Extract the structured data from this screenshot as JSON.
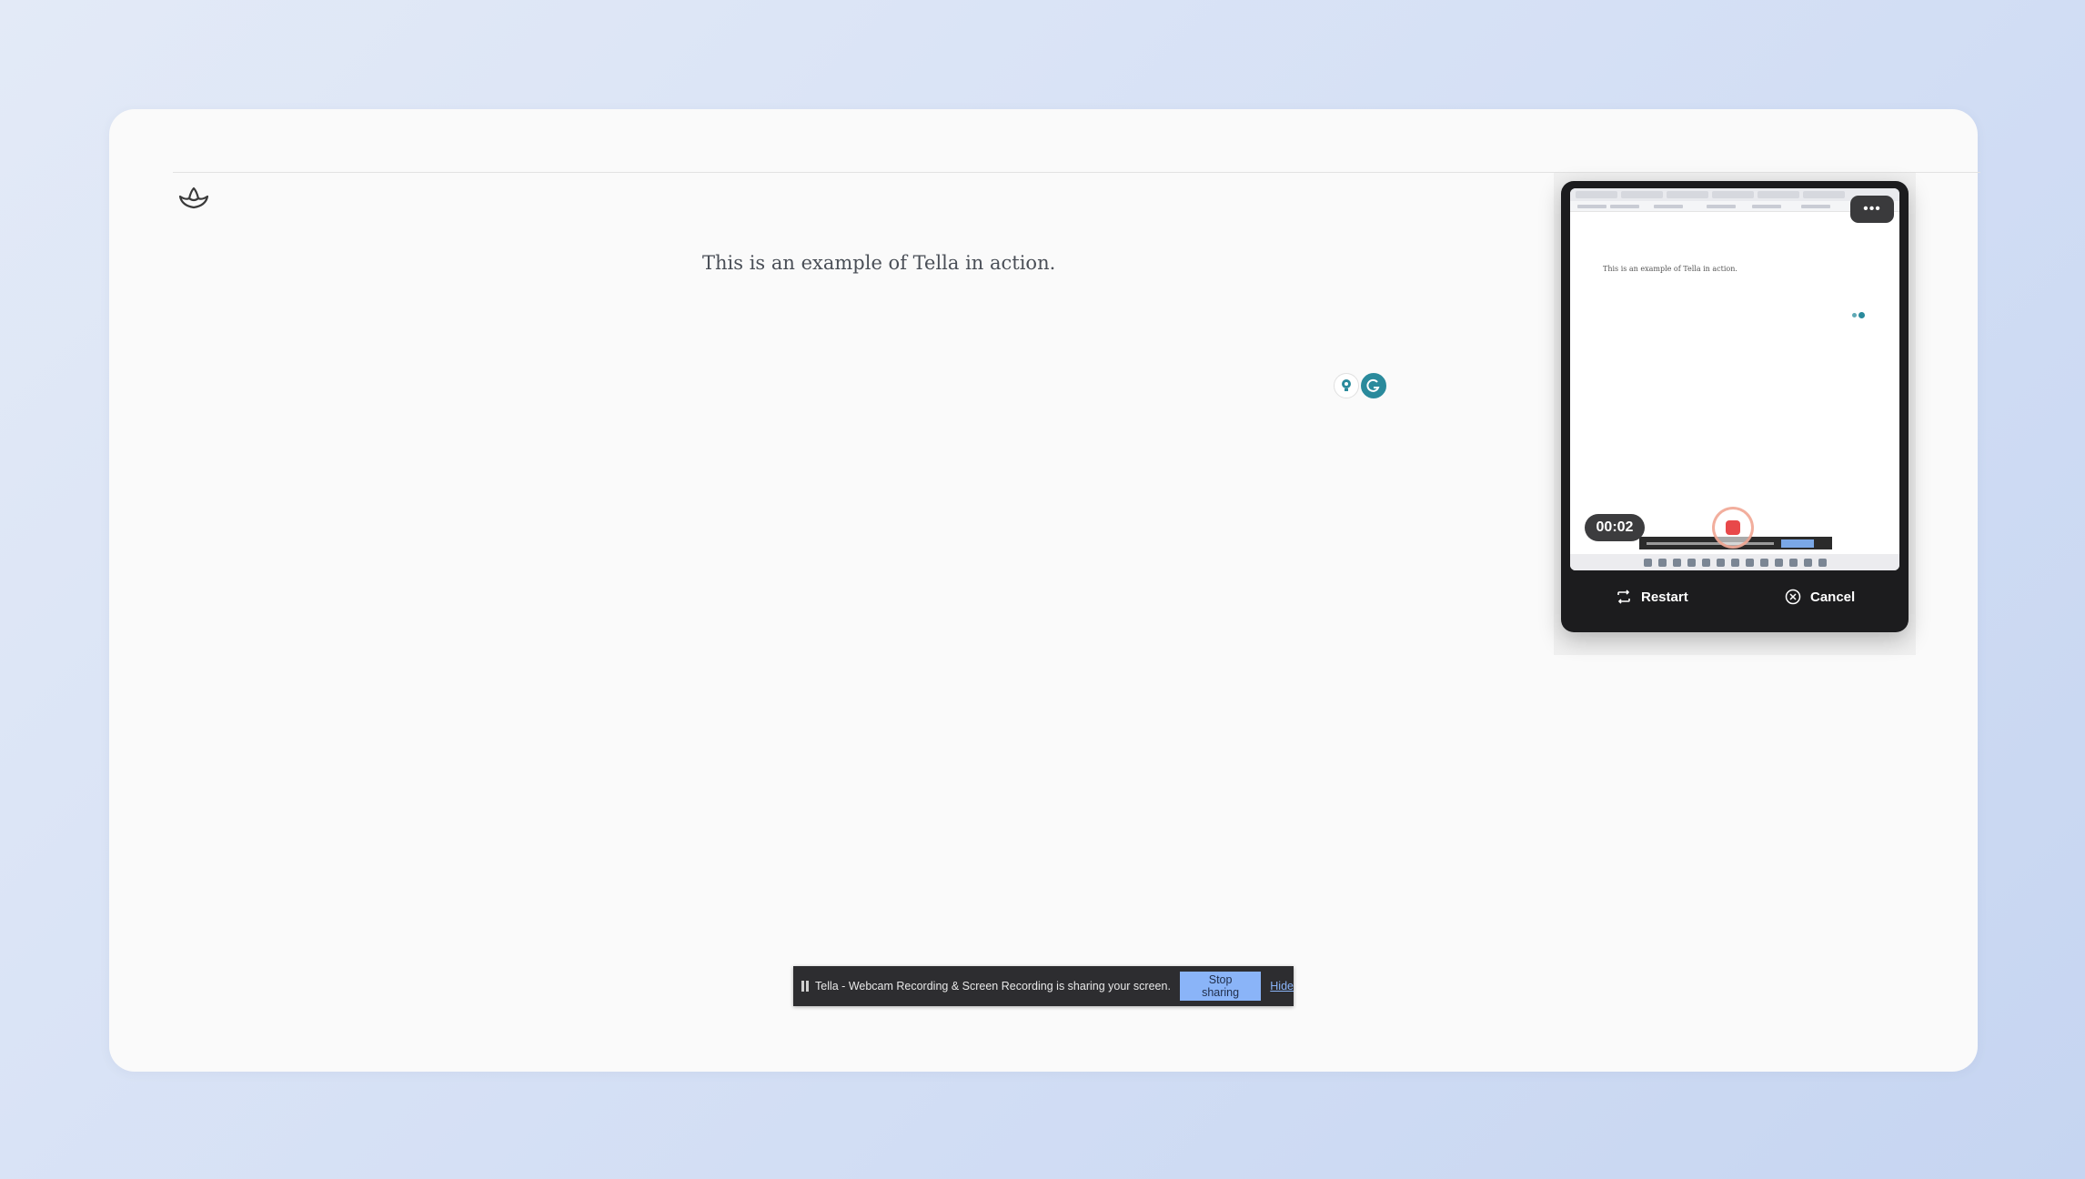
{
  "document": {
    "text": "This is an example of Tella in action."
  },
  "extensions": {
    "icons": [
      "lightbulb-icon",
      "grammarly-icon"
    ]
  },
  "recorder": {
    "timer": "00:02",
    "restart_label": "Restart",
    "cancel_label": "Cancel",
    "menu_label": "•••",
    "preview_text": "This is an example of Tella in action.",
    "record_color": "#e8484a"
  },
  "share_bar": {
    "message": "Tella - Webcam Recording & Screen Recording is sharing your screen.",
    "stop_label": "Stop sharing",
    "hide_label": "Hide",
    "accent": "#8ab4f8"
  }
}
